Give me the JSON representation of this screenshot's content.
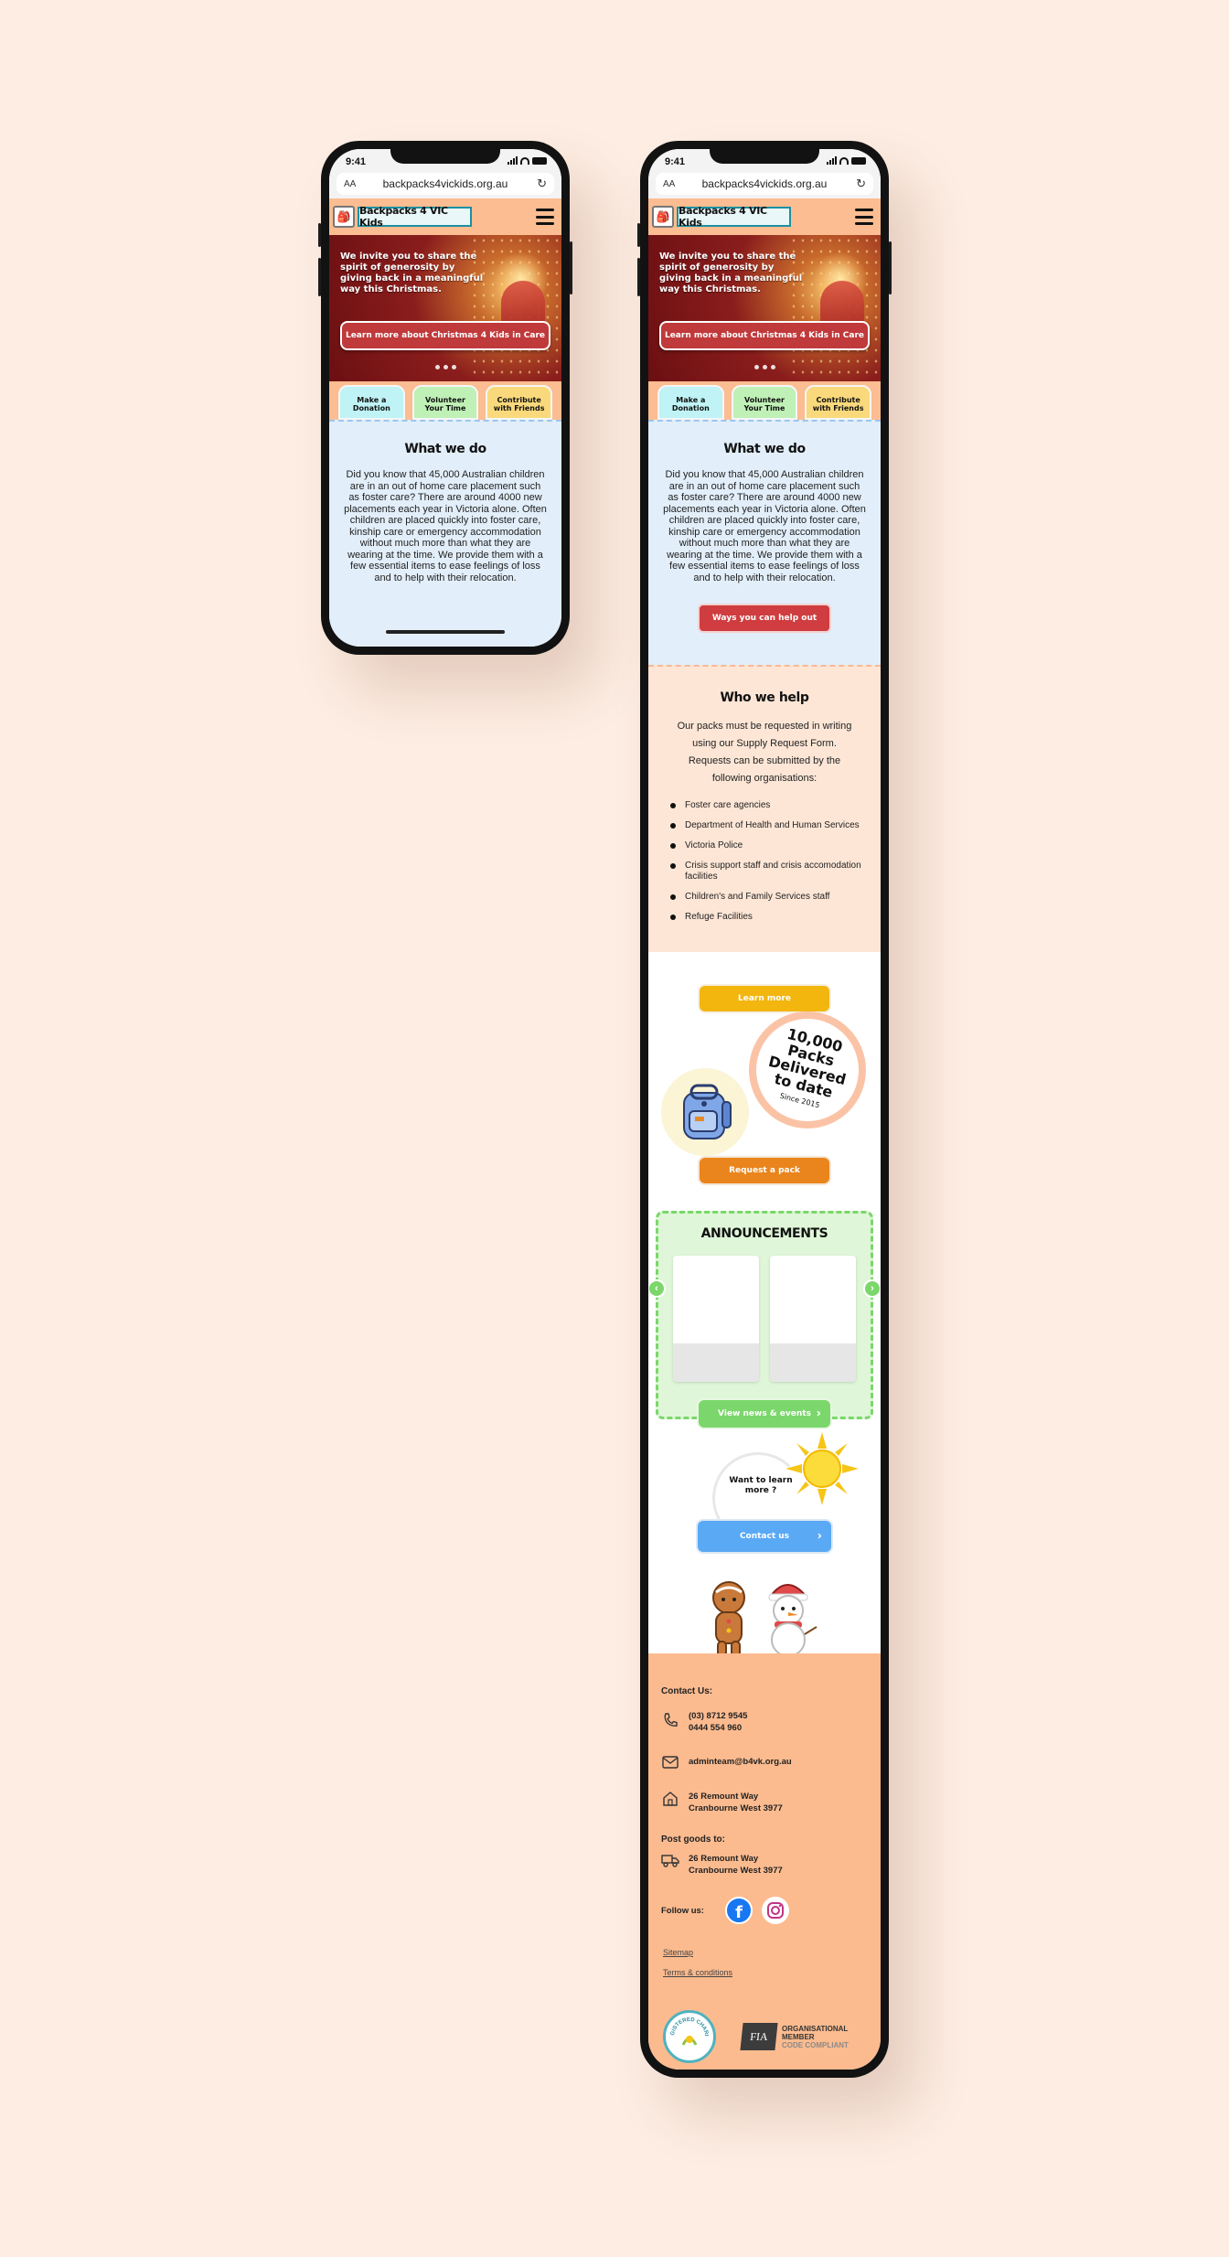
{
  "status": {
    "time": "9:41"
  },
  "browser": {
    "text_size": "AA",
    "url": "backpacks4vickids.org.au"
  },
  "site": {
    "logo_text": "Backpacks 4 VIC Kids"
  },
  "hero": {
    "text": "We invite you to share the spirit of generosity by giving back in a meaningful way this Christmas.",
    "button": "Learn more about Christmas 4 Kids in Care"
  },
  "tabs": [
    "Make a Donation",
    "Volunteer Your Time",
    "Contribute with Friends"
  ],
  "what_we_do": {
    "title": "What we do",
    "text": "Did you know that 45,000 Australian children are in an out of home care placement such as foster care? There are around 4000 new placements each year in Victoria alone. Often children are placed quickly into foster care, kinship care or emergency accommodation without much more than what they are wearing at the time. We provide them with a few essential items to ease feelings of loss and to help with their relocation.",
    "button": "Ways you can help out"
  },
  "who_we_help": {
    "title": "Who we help",
    "intro": "Our packs must be requested in writing using our Supply Request Form. Requests can be submitted by the following organisations:",
    "items": [
      "Foster care agencies",
      "Department of Health and Human Services",
      "Victoria Police",
      "Crisis support staff and crisis accomodation facilities",
      "Children's and Family Services staff",
      "Refuge Facilities"
    ],
    "button": "Learn more"
  },
  "packs": {
    "line1": "10,000",
    "line2": "Packs",
    "line3": "Delivered",
    "line4": "to date",
    "since": "Since 2015",
    "button": "Request a pack"
  },
  "announcements": {
    "title": "ANNOUNCEMENTS",
    "button": "View news & events"
  },
  "learn_more": {
    "question": "Want to learn more ?",
    "button": "Contact us"
  },
  "footer": {
    "contact_label": "Contact Us:",
    "phone1": "(03) 8712 9545",
    "phone2": "0444 554 960",
    "email": "adminteam@b4vk.org.au",
    "address1": "26 Remount Way",
    "address2": "Cranbourne West 3977",
    "post_label": "Post goods to:",
    "post1": "26 Remount Way",
    "post2": "Cranbourne West 3977",
    "follow_label": "Follow us:",
    "sitemap": "Sitemap",
    "terms": "Terms & conditions",
    "fia_line1": "ORGANISATIONAL",
    "fia_line2": "MEMBER",
    "fia_line3": "CODE COMPLIANT",
    "fia_mark": "FIA",
    "charity_text": "REGISTERED CHARITY"
  },
  "colors": {
    "background": "#fdede3",
    "header": "#fbbd91",
    "red_button": "#cf3d40",
    "yellow_button": "#f2b60f",
    "orange_button": "#e9851c",
    "green_button": "#7bd76b",
    "blue_button": "#5aa9f5"
  }
}
